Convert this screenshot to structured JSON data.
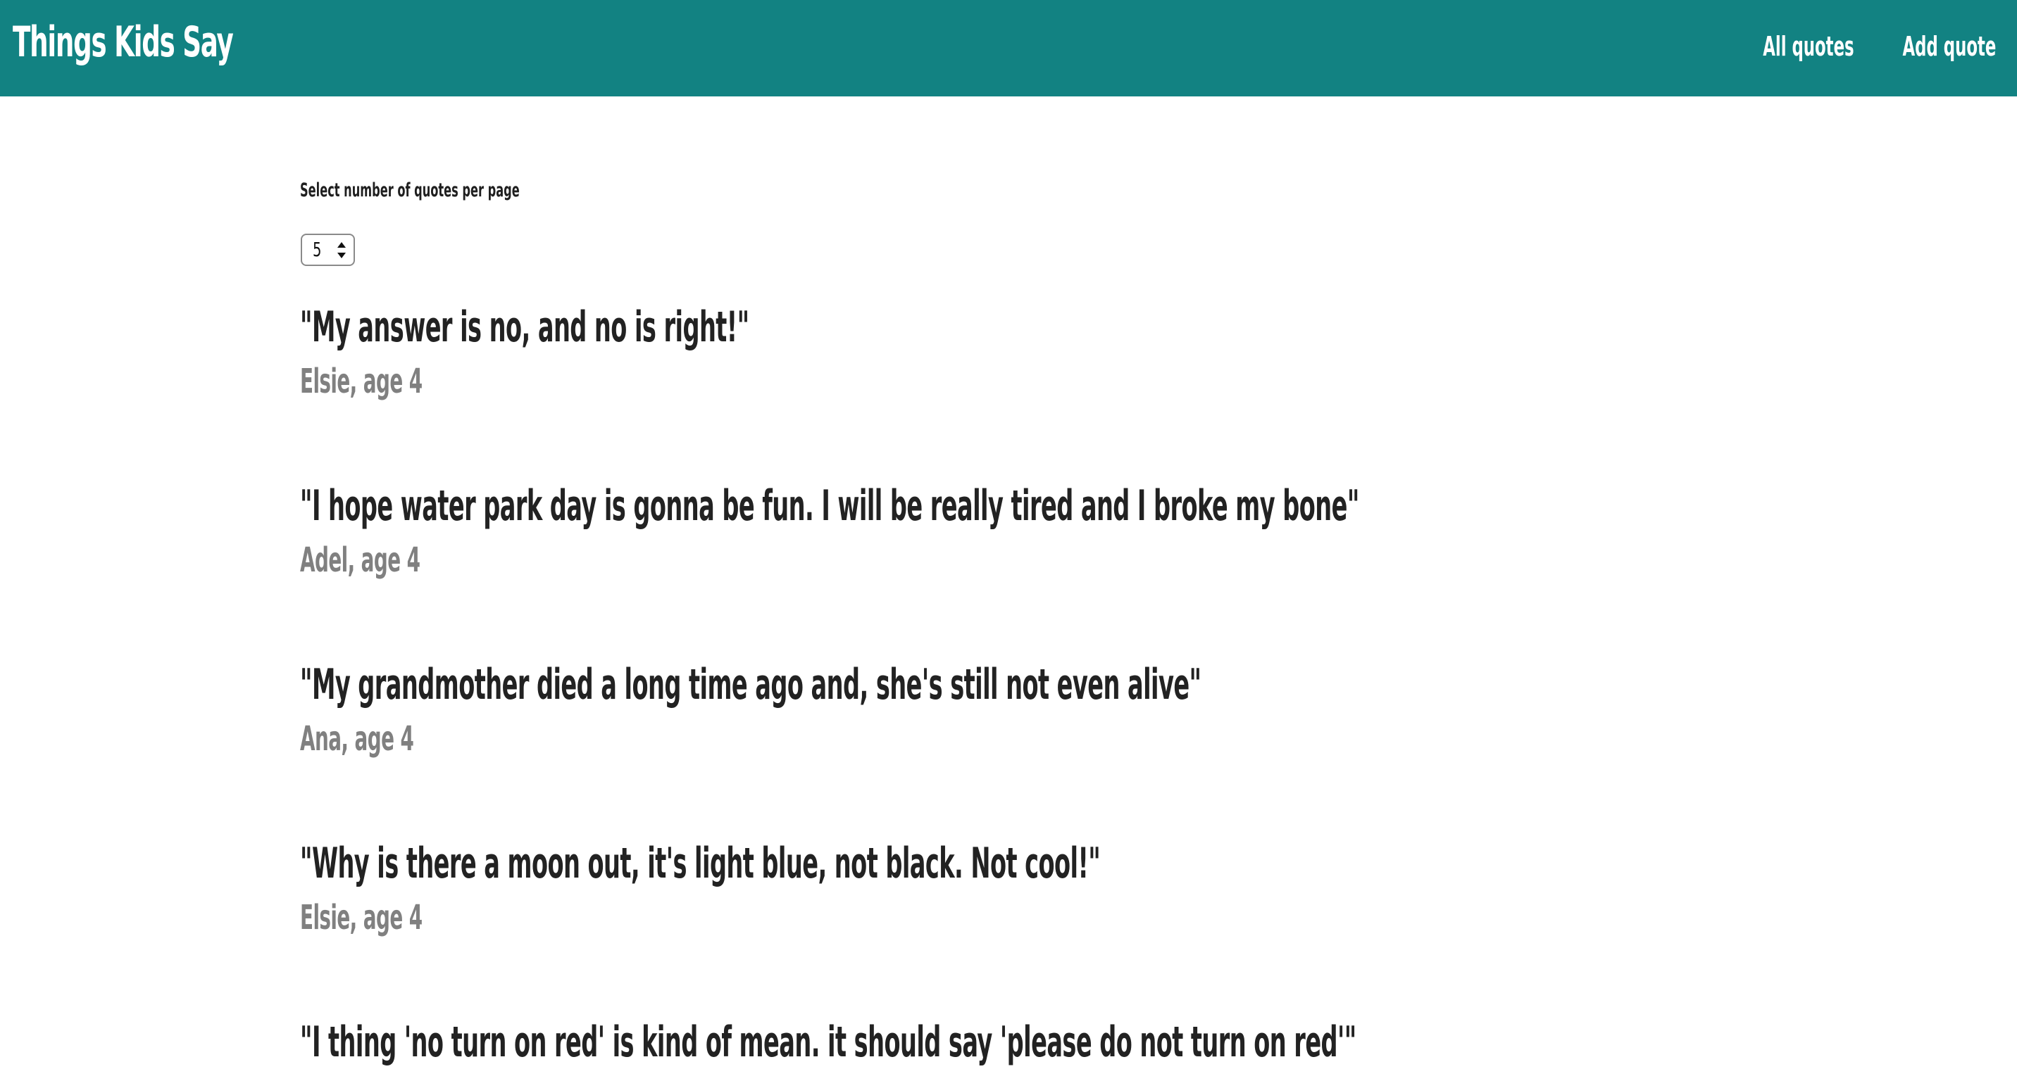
{
  "app": {
    "title": "Things Kids Say"
  },
  "nav": {
    "items": [
      {
        "label": "All quotes"
      },
      {
        "label": "Add quote"
      }
    ]
  },
  "controls": {
    "per_page_label": "Select number of quotes per page",
    "per_page_value": "5"
  },
  "quotes": [
    {
      "text": "\"My answer is no, and no is right!\"",
      "author": "Elsie, age 4"
    },
    {
      "text": "\"I hope water park day is gonna be fun. I will be really tired and I broke my bone\"",
      "author": "Adel, age 4"
    },
    {
      "text": "\"My grandmother died a long time ago and, she's still not even alive\"",
      "author": "Ana, age 4"
    },
    {
      "text": "\"Why is there a moon out, it's light blue, not black. Not cool!\"",
      "author": "Elsie, age 4"
    },
    {
      "text": "\"I thing 'no turn on red' is kind of mean. it should say 'please do not turn on red'\"",
      "author": ""
    }
  ],
  "colors": {
    "header_bg": "#128282",
    "quote_text": "#222222",
    "author_text": "#808080"
  }
}
